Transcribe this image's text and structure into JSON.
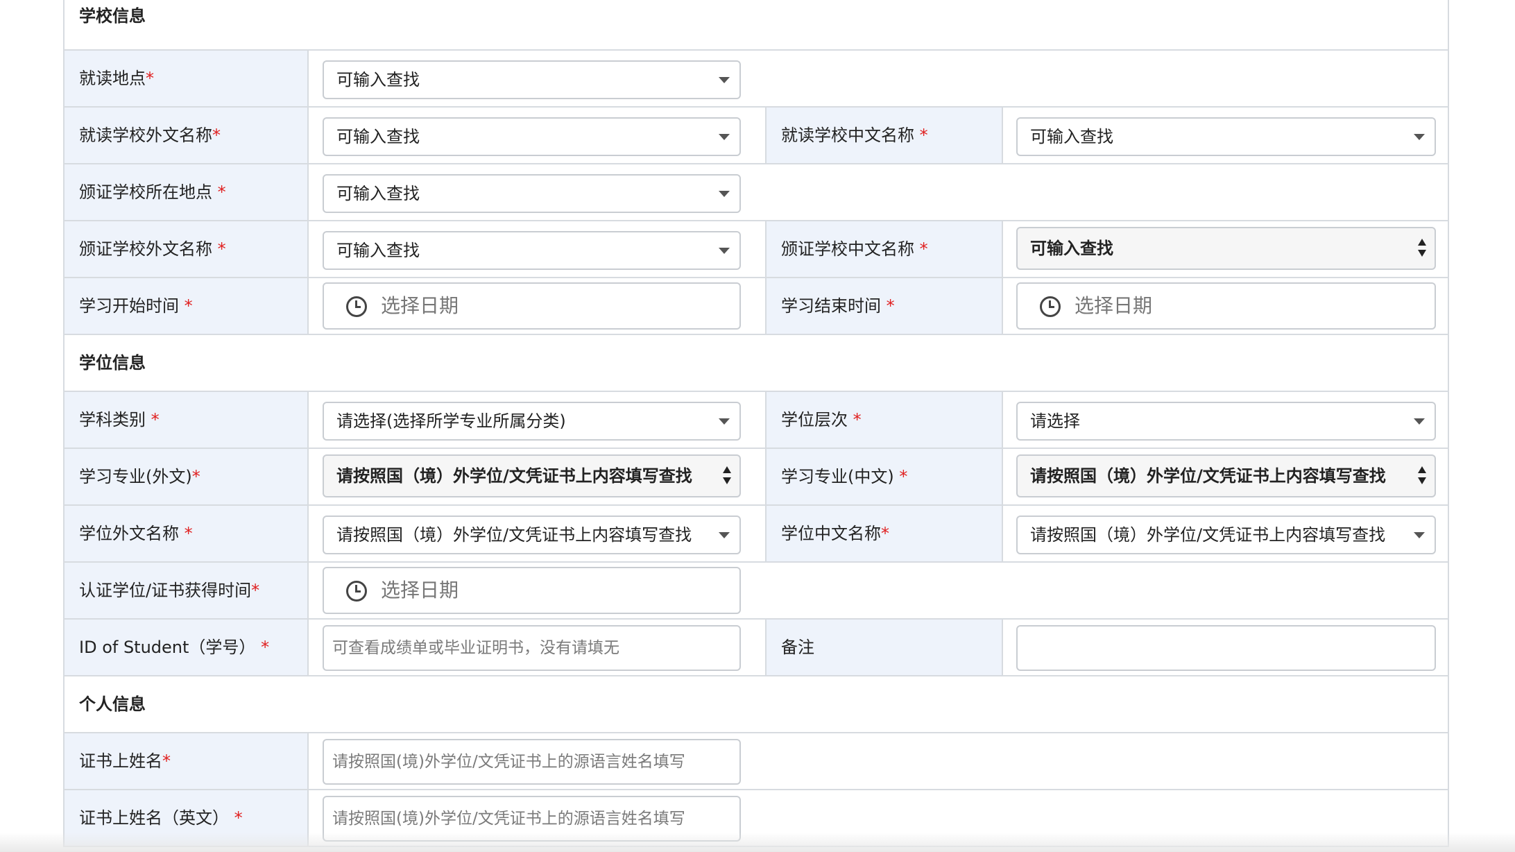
{
  "sections": {
    "school": "学校信息",
    "degree": "学位信息",
    "personal": "个人信息"
  },
  "star": "*",
  "fields": {
    "study_place": {
      "label": "就读地点",
      "placeholder": "可输入查找"
    },
    "school_foreign": {
      "label": "就读学校外文名称",
      "placeholder": "可输入查找"
    },
    "school_cn": {
      "label": "就读学校中文名称 ",
      "placeholder": "可输入查找"
    },
    "issuer_place": {
      "label": "颁证学校所在地点 ",
      "placeholder": "可输入查找"
    },
    "issuer_foreign": {
      "label": "颁证学校外文名称 ",
      "placeholder": "可输入查找"
    },
    "issuer_cn": {
      "label": "颁证学校中文名称 ",
      "value": "可输入查找"
    },
    "study_start": {
      "label": "学习开始时间 ",
      "placeholder": "选择日期"
    },
    "study_end": {
      "label": "学习结束时间 ",
      "placeholder": "选择日期"
    },
    "subject": {
      "label": "学科类别 ",
      "placeholder": "请选择(选择所学专业所属分类)"
    },
    "degree_level": {
      "label": "学位层次 ",
      "placeholder": "请选择"
    },
    "major_foreign": {
      "label": "学习专业(外文)",
      "value": "请按照国（境）外学位/文凭证书上内容填写查找"
    },
    "major_cn": {
      "label": "学习专业(中文) ",
      "value": "请按照国（境）外学位/文凭证书上内容填写查找"
    },
    "degree_foreign": {
      "label": "学位外文名称 ",
      "placeholder": "请按照国（境）外学位/文凭证书上内容填写查找"
    },
    "degree_cn": {
      "label": "学位中文名称",
      "placeholder": "请按照国（境）外学位/文凭证书上内容填写查找"
    },
    "cert_time": {
      "label": "认证学位/证书获得时间",
      "placeholder": "选择日期"
    },
    "student_id": {
      "label": "ID of Student（学号） ",
      "placeholder": "可查看成绩单或毕业证明书，没有请填无"
    },
    "remark": {
      "label": "备注",
      "value": ""
    },
    "name_cert": {
      "label": "证书上姓名",
      "placeholder": "请按照国(境)外学位/文凭证书上的源语言姓名填写"
    },
    "name_en": {
      "label": "证书上姓名（英文） ",
      "placeholder": "请按照国(境)外学位/文凭证书上的源语言姓名填写"
    }
  }
}
